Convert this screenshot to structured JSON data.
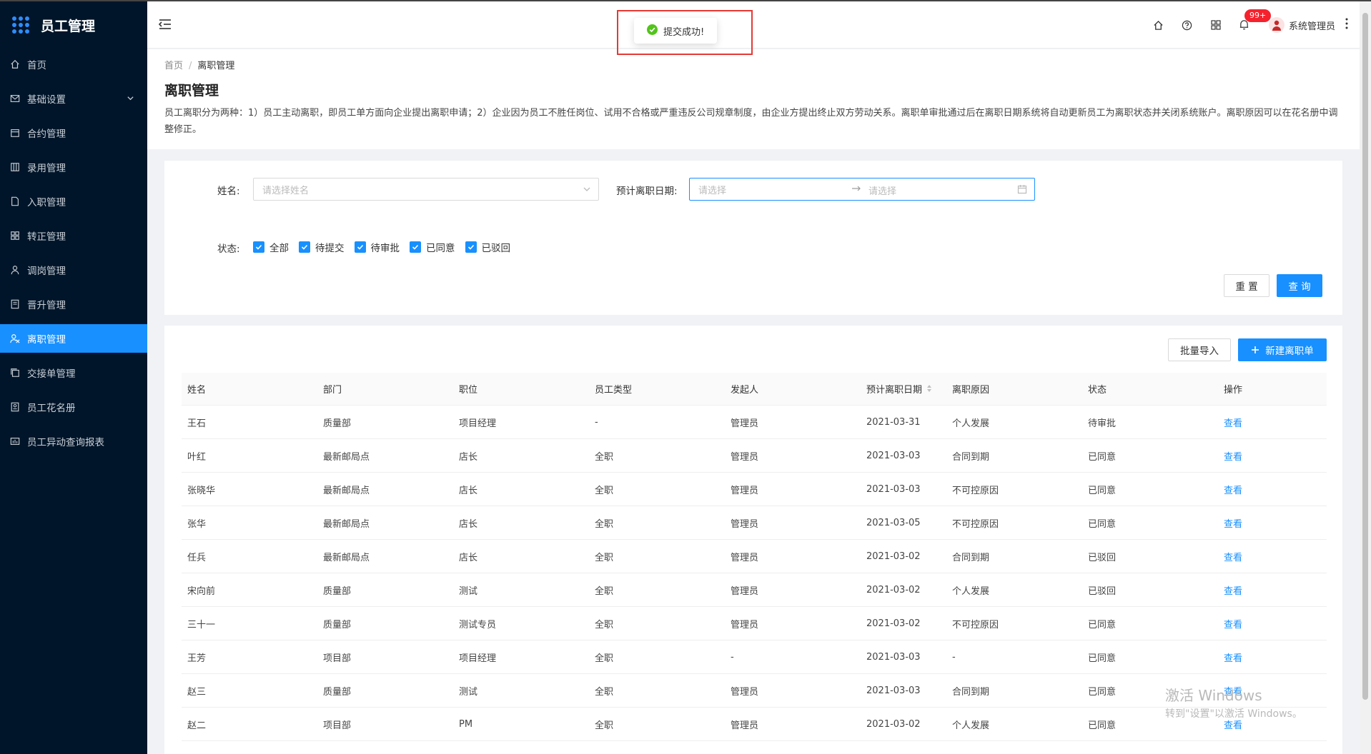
{
  "app": {
    "title": "员工管理"
  },
  "sidebar": {
    "items": [
      {
        "label": "首页",
        "icon": "home-icon"
      },
      {
        "label": "基础设置",
        "icon": "mail-icon",
        "has_children": true
      },
      {
        "label": "合约管理",
        "icon": "calendar-icon"
      },
      {
        "label": "录用管理",
        "icon": "layout-icon"
      },
      {
        "label": "入职管理",
        "icon": "file-icon"
      },
      {
        "label": "转正管理",
        "icon": "grid-icon"
      },
      {
        "label": "调岗管理",
        "icon": "user-icon"
      },
      {
        "label": "晋升管理",
        "icon": "doc-icon"
      },
      {
        "label": "离职管理",
        "icon": "leave-icon",
        "active": true
      },
      {
        "label": "交接单管理",
        "icon": "copy-icon"
      },
      {
        "label": "员工花名册",
        "icon": "roster-icon"
      },
      {
        "label": "员工异动查询报表",
        "icon": "report-icon"
      }
    ]
  },
  "header": {
    "notification_count": "99+",
    "user_name": "系统管理员"
  },
  "toast": {
    "message": "提交成功!"
  },
  "breadcrumb": {
    "home": "首页",
    "sep": "/",
    "current": "离职管理"
  },
  "page": {
    "title": "离职管理",
    "description": "员工离职分为两种：1）员工主动离职，即员工单方面向企业提出离职申请；2）企业因为员工不胜任岗位、试用不合格或严重违反公司规章制度，由企业方提出终止双方劳动关系。离职单审批通过后在离职日期系统将自动更新员工为离职状态并关闭系统账户。离职原因可以在花名册中调整修正。"
  },
  "filter": {
    "name_label": "姓名:",
    "name_placeholder": "请选择姓名",
    "date_label": "预计离职日期:",
    "date_start_placeholder": "请选择",
    "date_end_placeholder": "请选择",
    "status_label": "状态:",
    "statuses": [
      "全部",
      "待提交",
      "待审批",
      "已同意",
      "已驳回"
    ],
    "reset_label": "重 置",
    "query_label": "查 询"
  },
  "toolbar": {
    "import_label": "批量导入",
    "new_label": "新建离职单"
  },
  "table": {
    "columns": [
      "姓名",
      "部门",
      "职位",
      "员工类型",
      "发起人",
      "预计离职日期",
      "离职原因",
      "状态",
      "操作"
    ],
    "rows": [
      [
        "王石",
        "质量部",
        "项目经理",
        "-",
        "管理员",
        "2021-03-31",
        "个人发展",
        "待审批",
        "查看"
      ],
      [
        "叶红",
        "最新邮局点",
        "店长",
        "全职",
        "管理员",
        "2021-03-03",
        "合同到期",
        "已同意",
        "查看"
      ],
      [
        "张晓华",
        "最新邮局点",
        "店长",
        "全职",
        "管理员",
        "2021-03-03",
        "不可控原因",
        "已同意",
        "查看"
      ],
      [
        "张华",
        "最新邮局点",
        "店长",
        "全职",
        "管理员",
        "2021-03-05",
        "不可控原因",
        "已同意",
        "查看"
      ],
      [
        "任兵",
        "最新邮局点",
        "店长",
        "全职",
        "管理员",
        "2021-03-02",
        "合同到期",
        "已驳回",
        "查看"
      ],
      [
        "宋向前",
        "质量部",
        "测试",
        "全职",
        "管理员",
        "2021-03-02",
        "个人发展",
        "已驳回",
        "查看"
      ],
      [
        "三十一",
        "质量部",
        "测试专员",
        "全职",
        "管理员",
        "2021-03-02",
        "不可控原因",
        "已同意",
        "查看"
      ],
      [
        "王芳",
        "项目部",
        "项目经理",
        "全职",
        "-",
        "2021-03-03",
        "-",
        "已同意",
        "查看"
      ],
      [
        "赵三",
        "质量部",
        "测试",
        "全职",
        "管理员",
        "2021-03-03",
        "合同到期",
        "已同意",
        "查看"
      ],
      [
        "赵二",
        "项目部",
        "PM",
        "全职",
        "管理员",
        "2021-03-02",
        "个人发展",
        "已同意",
        "查看"
      ]
    ]
  },
  "watermark": {
    "line1": "激活 Windows",
    "line2": "转到\"设置\"以激活 Windows。"
  }
}
